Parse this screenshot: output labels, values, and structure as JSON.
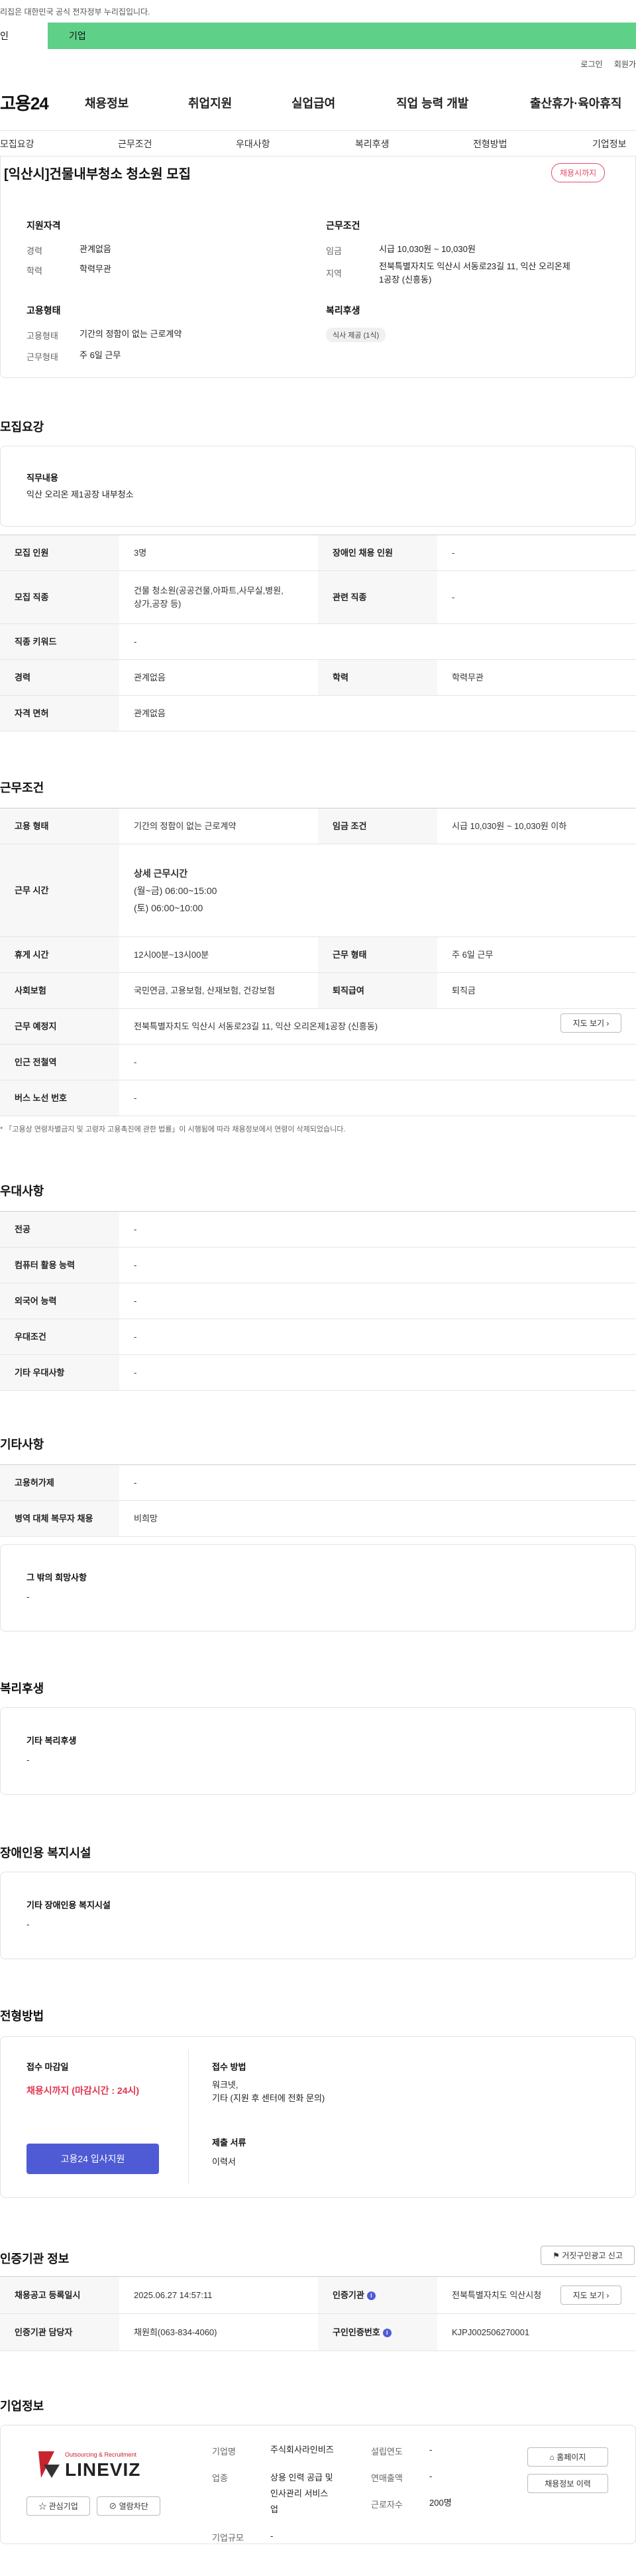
{
  "top_note": "리집은 대한민국 공식 전자정부 누리집입니다.",
  "green_tabs": [
    "인",
    "기업"
  ],
  "top_links": [
    "로그인",
    "회원가"
  ],
  "logo": "고용24",
  "main_nav": [
    "채용정보",
    "취업지원",
    "실업급여",
    "직업 능력 개발",
    "출산휴가·육아휴직"
  ],
  "sub_nav": [
    "모집요강",
    "근무조건",
    "우대사항",
    "복리후생",
    "전형방법",
    "기업정보"
  ],
  "title": "[익산시]건물내부청소 청소원 모집",
  "status_badge": "채용시까지",
  "summary": {
    "qual_title": "지원자격",
    "career_label": "경력",
    "career_value": "관계없음",
    "edu_label": "학력",
    "edu_value": "학력무관",
    "cond_title": "근무조건",
    "wage_label": "임금",
    "wage_value": "시급 10,030원 ~ 10,030원",
    "region_label": "지역",
    "region_value1": "전북특별자치도 익산시 서동로23길 11, 익산 오리온제",
    "region_value2": "1공장 (신흥동)",
    "emp_title": "고용형태",
    "emptype_label": "고용형태",
    "emptype_value": "기간의 정함이 없는 근로계약",
    "workform_label": "근무형태",
    "workform_value": "주 6일 근무",
    "welfare_title": "복리후생",
    "welfare_chip": "식사 제공 (1식)"
  },
  "recruit": {
    "title": "모집요강",
    "duty_label": "직무내용",
    "duty_value": "익산 오리온 제1공장 내부청소",
    "rows": {
      "count_k": "모집 인원",
      "count_v": "3명",
      "disabled_k": "장애인 채용 인원",
      "disabled_v": "-",
      "job_k": "모집 직종",
      "job_v1": "건물 청소원(공공건물,아파트,사무실,병원,",
      "job_v2": "상가,공장 등)",
      "related_k": "관련 직종",
      "related_v": "-",
      "keyword_k": "직종 키워드",
      "keyword_v": "-",
      "career_k": "경력",
      "career_v": "관계없음",
      "edu_k": "학력",
      "edu_v": "학력무관",
      "license_k": "자격 면허",
      "license_v": "관계없음"
    }
  },
  "conditions": {
    "title": "근무조건",
    "emptype_k": "고용 형태",
    "emptype_v": "기간의 정함이 없는 근로계약",
    "wage_k": "임금 조건",
    "wage_v": "시급 10,030원 ~ 10,030원 이하",
    "hours_k": "근무 시간",
    "hours_title": "상세 근무시간",
    "hours_v1": "(월~금) 06:00~15:00",
    "hours_v2": "(토) 06:00~10:00",
    "break_k": "휴게 시간",
    "break_v": "12시00분~13시00분",
    "form_k": "근무 형태",
    "form_v": "주 6일 근무",
    "insurance_k": "사회보험",
    "insurance_v": "국민연금, 고용보험, 산재보험, 건강보험",
    "retire_k": "퇴직급여",
    "retire_v": "퇴직금",
    "place_k": "근무 예정지",
    "place_v": "전북특별자치도 익산시 서동로23길 11, 익산 오리온제1공장 (신흥동)",
    "map_btn": "지도 보기",
    "subway_k": "인근 전철역",
    "subway_v": "-",
    "bus_k": "버스 노선 번호",
    "bus_v": "-",
    "note": "* 「고용상 연령차별금지 및 고령자 고용촉진에 관한 법률」이 시행됨에 따라 채용정보에서 연령이 삭제되었습니다."
  },
  "preference": {
    "title": "우대사항",
    "major_k": "전공",
    "major_v": "-",
    "computer_k": "컴퓨터 활용 능력",
    "computer_v": "-",
    "lang_k": "외국어 능력",
    "lang_v": "-",
    "cond_k": "우대조건",
    "cond_v": "-",
    "etc_k": "기타 우대사항",
    "etc_v": "-"
  },
  "etc": {
    "title": "기타사항",
    "permit_k": "고용허가제",
    "permit_v": "-",
    "military_k": "병역 대체 복무자 채용",
    "military_v": "비희망",
    "wish_label": "그 밖의 희망사항",
    "wish_value": "-"
  },
  "welfare": {
    "title": "복리후생",
    "label": "기타 복리후생",
    "value": "-"
  },
  "disabled_fac": {
    "title": "장애인용 복지시설",
    "label": "기타 장애인용 복지시설",
    "value": "-"
  },
  "selection": {
    "title": "전형방법",
    "deadline_label": "접수 마감일",
    "deadline_value": "채용시까지 (마감시간 : 24시)",
    "apply_btn": "고용24 입사지원",
    "method_label": "접수 방법",
    "method_v1": "워크넷,",
    "method_v2": "기타 (지원 후 센터에 전화 문의)",
    "docs_label": "제출 서류",
    "docs_value": "이력서"
  },
  "cert": {
    "title": "인증기관 정보",
    "report_btn": "거짓구인광고 신고",
    "date_k": "채용공고 등록일시",
    "date_v": "2025.06.27 14:57:11",
    "org_k": "인증기관",
    "org_v": "전북특별자치도 익산시청",
    "map_btn": "지도 보기",
    "manager_k": "인증기관 담당자",
    "manager_v": "채원희(063-834-4060)",
    "num_k": "구인인증번호",
    "num_v": "KJPJ002506270001"
  },
  "company": {
    "title": "기업정보",
    "logo_top": "Outsourcing & Recruitment",
    "logo_main": "LINEVIZ",
    "follow_btn": "관심기업",
    "block_btn": "열람차단",
    "name_k": "기업명",
    "name_v": "주식회사라인비즈",
    "industry_k": "업종",
    "industry_v1": "상용 인력 공급 및",
    "industry_v2": "인사관리 서비스",
    "industry_v3": "업",
    "size_k": "기업규모",
    "size_v": "-",
    "year_k": "설립연도",
    "year_v": "-",
    "sales_k": "연매출액",
    "sales_v": "-",
    "emp_k": "근로자수",
    "emp_v": "200명",
    "home_btn": "홈페이지",
    "history_btn": "채용정보 이력"
  },
  "colors": {
    "green": "#5fd087",
    "red": "#e84a6a",
    "blue": "#4f5bd5"
  }
}
